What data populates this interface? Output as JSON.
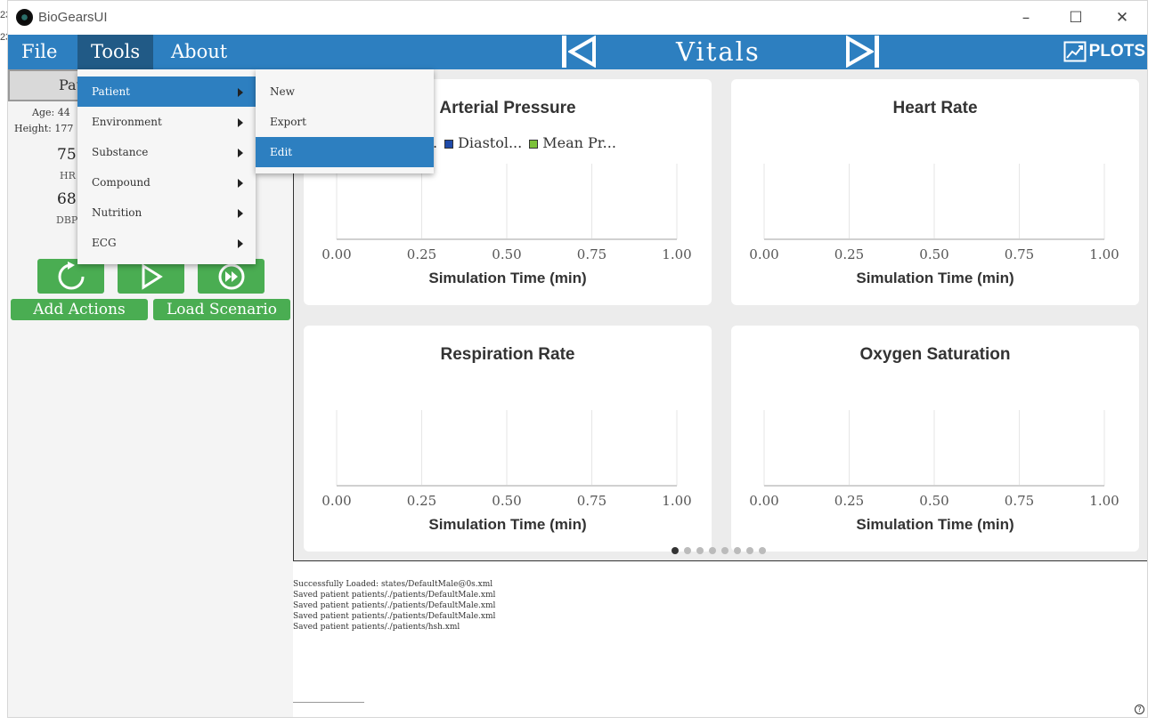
{
  "window": {
    "title": "BioGearsUI",
    "controls": {
      "minimize": "–",
      "maximize": "☐",
      "close": "✕"
    }
  },
  "stray": {
    "top": "23",
    "second": "23"
  },
  "menubar": {
    "items": [
      "File",
      "Tools",
      "About"
    ],
    "active": "Tools",
    "view_title": "Vitals",
    "plots_label": "PLOTS"
  },
  "sidebar": {
    "tab_label": "Pat",
    "age": "Age: 44",
    "height": "Height: 177",
    "vitals": [
      {
        "value": "75",
        "label": "HR"
      },
      {
        "value": "68",
        "label": "DBP"
      }
    ],
    "add_actions": "Add Actions",
    "load_scenario": "Load Scenario"
  },
  "tools_menu": {
    "items": [
      "Patient",
      "Environment",
      "Substance",
      "Compound",
      "Nutrition",
      "ECG"
    ],
    "highlighted": "Patient"
  },
  "patient_submenu": {
    "items": [
      "New",
      "Export",
      "Edit"
    ],
    "highlighted": "Edit"
  },
  "charts": [
    {
      "title": "Arterial Pressure",
      "xlabel": "Simulation Time (min)",
      "x_ticks": [
        "0.00",
        "0.25",
        "0.50",
        "0.75",
        "1.00"
      ],
      "legend": [
        {
          "name": ".",
          "color": ""
        },
        {
          "name": "Diastol...",
          "color": "#1f4aa8"
        },
        {
          "name": "Mean Pr...",
          "color": "#7cc13a"
        }
      ]
    },
    {
      "title": "Heart Rate",
      "xlabel": "Simulation Time (min)",
      "x_ticks": [
        "0.00",
        "0.25",
        "0.50",
        "0.75",
        "1.00"
      ]
    },
    {
      "title": "Respiration Rate",
      "xlabel": "Simulation Time (min)",
      "x_ticks": [
        "0.00",
        "0.25",
        "0.50",
        "0.75",
        "1.00"
      ]
    },
    {
      "title": "Oxygen Saturation",
      "xlabel": "Simulation Time (min)",
      "x_ticks": [
        "0.00",
        "0.25",
        "0.50",
        "0.75",
        "1.00"
      ]
    }
  ],
  "pager": {
    "count": 8,
    "active_index": 0
  },
  "log": [
    "Successfully Loaded: states/DefaultMale@0s.xml",
    "Saved patient patients/./patients/DefaultMale.xml",
    "Saved patient patients/./patients/DefaultMale.xml",
    "Saved patient patients/./patients/DefaultMale.xml",
    "Saved patient patients/./patients/hsh.xml"
  ],
  "colors": {
    "accent": "#2d7fc0",
    "accent_dark": "#215a86",
    "button_green": "#4aad52"
  },
  "help": "?"
}
